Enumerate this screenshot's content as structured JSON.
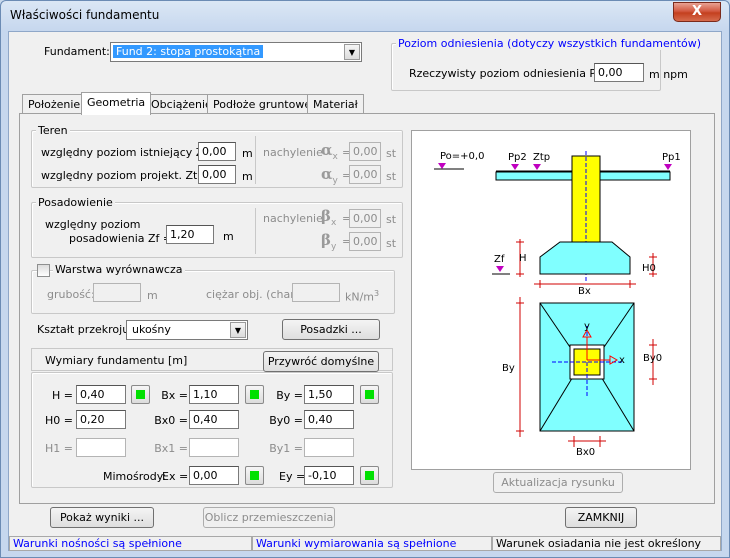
{
  "window": {
    "title": "Właściwości fundamentu",
    "close": "X"
  },
  "fundament": {
    "label": "Fundament:",
    "value": "Fund 2: stopa prostokątna"
  },
  "ref_level": {
    "group_title": "Poziom odniesienia  (dotyczy wszystkich fundamentów)",
    "label": "Rzeczywisty poziom odniesienia  Po =",
    "value": "0,00",
    "unit": "m npm"
  },
  "tabs": [
    "Położenie",
    "Geometria",
    "Obciążenie",
    "Podłoże gruntowe",
    "Materiał"
  ],
  "teren": {
    "group_title": "Teren",
    "zt_label": "względny poziom istniejący  Zt =",
    "zt_value": "0,00",
    "zt_unit": "m",
    "ztp_label": "względny poziom projekt.  Ztp =",
    "ztp_value": "0,00",
    "ztp_unit": "m",
    "slope_label": "nachylenie",
    "ax_sym": "α",
    "ax_sub": "x",
    "ax_value": "0,00",
    "ay_sym": "α",
    "ay_sub": "y",
    "ay_value": "0,00",
    "slope_unit": "st",
    "eq": "="
  },
  "posadowienie": {
    "group_title": "Posadowienie",
    "label_line1": "względny poziom",
    "label_line2": "posadowienia  Zf =",
    "value": "1,20",
    "unit": "m",
    "slope_label": "nachylenie",
    "bx_sym": "β",
    "bx_sub": "x",
    "bx_value": "0,00",
    "by_sym": "β",
    "by_sub": "y",
    "by_value": "0,00",
    "slope_unit": "st",
    "eq": "="
  },
  "warstwa": {
    "label": "Warstwa wyrównawcza",
    "checked": false,
    "thickness_label": "grubość:",
    "thickness_unit": "m",
    "weight_label": "ciężar obj. (char.):",
    "weight_unit": "kN/m",
    "weight_unit_sup": "3"
  },
  "shape": {
    "label": "Kształt przekroju:",
    "value": "ukośny",
    "posadzki_button": "Posadzki ..."
  },
  "dims": {
    "group_title": "Wymiary fundamentu  [m]",
    "restore_button": "Przywróć domyślne",
    "rows": [
      [
        {
          "label": "H =",
          "value": "0,40",
          "green": true,
          "enabled": true
        },
        {
          "label": "Bx =",
          "value": "1,10",
          "green": true,
          "enabled": true
        },
        {
          "label": "By =",
          "value": "1,50",
          "green": true,
          "enabled": true
        }
      ],
      [
        {
          "label": "H0 =",
          "value": "0,20",
          "green": false,
          "enabled": true
        },
        {
          "label": "Bx0 =",
          "value": "0,40",
          "green": false,
          "enabled": true
        },
        {
          "label": "By0 =",
          "value": "0,40",
          "green": false,
          "enabled": true
        }
      ],
      [
        {
          "label": "H1 =",
          "value": "",
          "green": false,
          "enabled": false
        },
        {
          "label": "Bx1 =",
          "value": "",
          "green": false,
          "enabled": false
        },
        {
          "label": "By1 =",
          "value": "",
          "green": false,
          "enabled": false
        }
      ]
    ],
    "mimosrody_label": "Mimośrody:",
    "ex_label": "Ex =",
    "ex_value": "0,00",
    "ey_label": "Ey =",
    "ey_value": "-0,10"
  },
  "drawing_labels": {
    "po": "Po=+0,0",
    "pp2": "Pp2",
    "ztp": "Ztp",
    "pp1": "Pp1",
    "zf": "Zf",
    "h": "H",
    "h0": "H0",
    "bx": "Bx",
    "by": "By",
    "by0": "By0",
    "bx0": "Bx0",
    "x": "x",
    "y": "y"
  },
  "buttons": {
    "update_drawing": "Aktualizacja rysunku",
    "show_results": "Pokaż wyniki ...",
    "compute_displacement": "Oblicz przemieszczenia",
    "close": "ZAMKNIJ"
  },
  "status": {
    "left": "Warunki nośności są spełnione",
    "middle": "Warunki wymiarowania są spełnione",
    "right": "Warunek osiadania nie jest określony"
  },
  "colors": {
    "accent_blue": "#0000ff",
    "foundation_fill": "#80ffff",
    "column_fill": "#ffff00",
    "marker_magenta": "#c000c0",
    "dimension_red": "#d00000",
    "ok_green": "#00e000"
  }
}
